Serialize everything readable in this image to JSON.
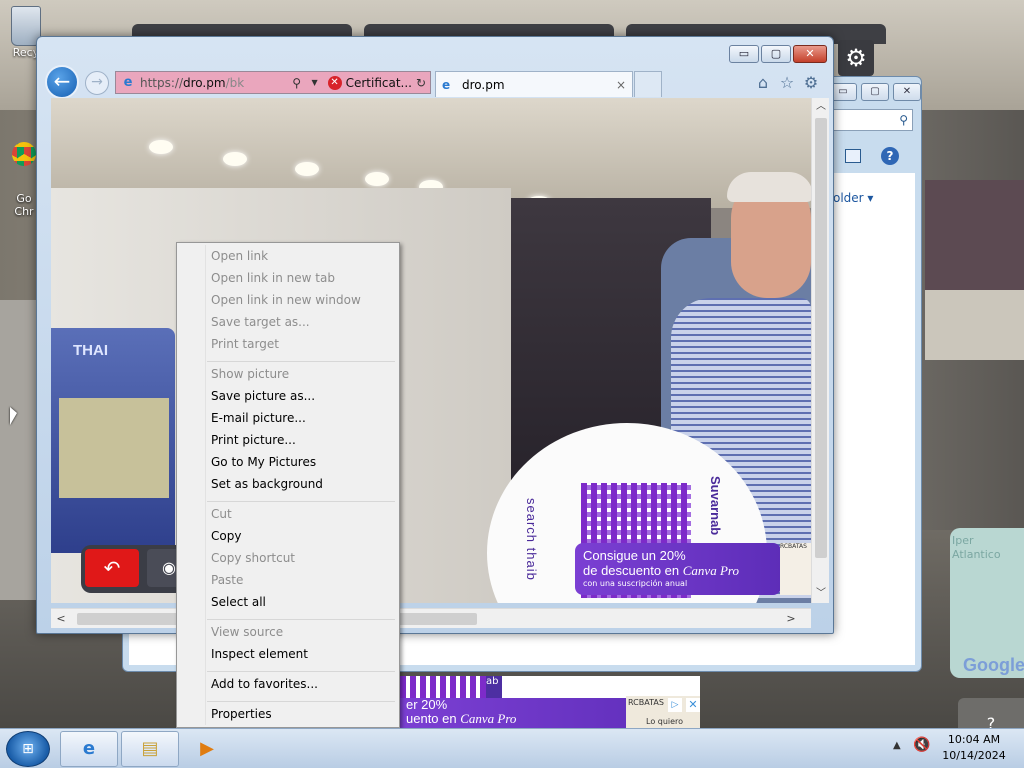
{
  "desktop": {
    "icons": [
      {
        "label": "Recy",
        "icon": "recycle-bin-icon"
      },
      {
        "label": "Go\nChr",
        "icon": "chrome-shortcut-icon"
      }
    ],
    "pad_text": "Iper\nAtlantico",
    "google_logo": "Google",
    "help_glyph": "?"
  },
  "browser": {
    "address": {
      "protocol": "https://",
      "host": "dro.pm",
      "path": "/bk",
      "certificate_text": "Certificat..."
    },
    "tab": {
      "title": "dro.pm",
      "close": "×"
    },
    "window_controls": {
      "minimize": "▭",
      "maximize": "▢",
      "close": "✕"
    },
    "page": {
      "box_logo": "THAI",
      "qr_vertical_left": "search thaib",
      "qr_vertical_right": "Suvarnab",
      "ad": {
        "line1": "Consigue un 20%",
        "line2_prefix": "de descuento en ",
        "line2_brand": "Canva Pro",
        "line3": "con una suscripción anual"
      },
      "side_ad_title": "RCBATAS"
    }
  },
  "context_menu": {
    "items": [
      {
        "label": "Open link",
        "enabled": false
      },
      {
        "label": "Open link in new tab",
        "enabled": false
      },
      {
        "label": "Open link in new window",
        "enabled": false
      },
      {
        "label": "Save target as...",
        "enabled": false
      },
      {
        "label": "Print target",
        "enabled": false
      },
      {
        "label": "Show picture",
        "enabled": false
      },
      {
        "label": "Save picture as...",
        "enabled": true
      },
      {
        "label": "E-mail picture...",
        "enabled": true
      },
      {
        "label": "Print picture...",
        "enabled": true
      },
      {
        "label": "Go to My Pictures",
        "enabled": true
      },
      {
        "label": "Set as background",
        "enabled": true
      },
      {
        "label": "Cut",
        "enabled": false
      },
      {
        "label": "Copy",
        "enabled": true
      },
      {
        "label": "Copy shortcut",
        "enabled": false
      },
      {
        "label": "Paste",
        "enabled": false
      },
      {
        "label": "Select all",
        "enabled": true
      },
      {
        "label": "View source",
        "enabled": false
      },
      {
        "label": "Inspect element",
        "enabled": true
      },
      {
        "label": "Add to favorites...",
        "enabled": true
      },
      {
        "label": "Properties",
        "enabled": true
      }
    ]
  },
  "explorer": {
    "folder_label": "older ▾"
  },
  "bottom_banner": {
    "line1": "er 20%",
    "line2_prefix": "uento en ",
    "line2_brand": "Canva Pro",
    "mag_title": "RCBATAS",
    "mag_sub": "Lo quiero",
    "ab": "ab"
  },
  "taskbar": {
    "time": "10:04 AM",
    "date": "10/14/2024"
  }
}
